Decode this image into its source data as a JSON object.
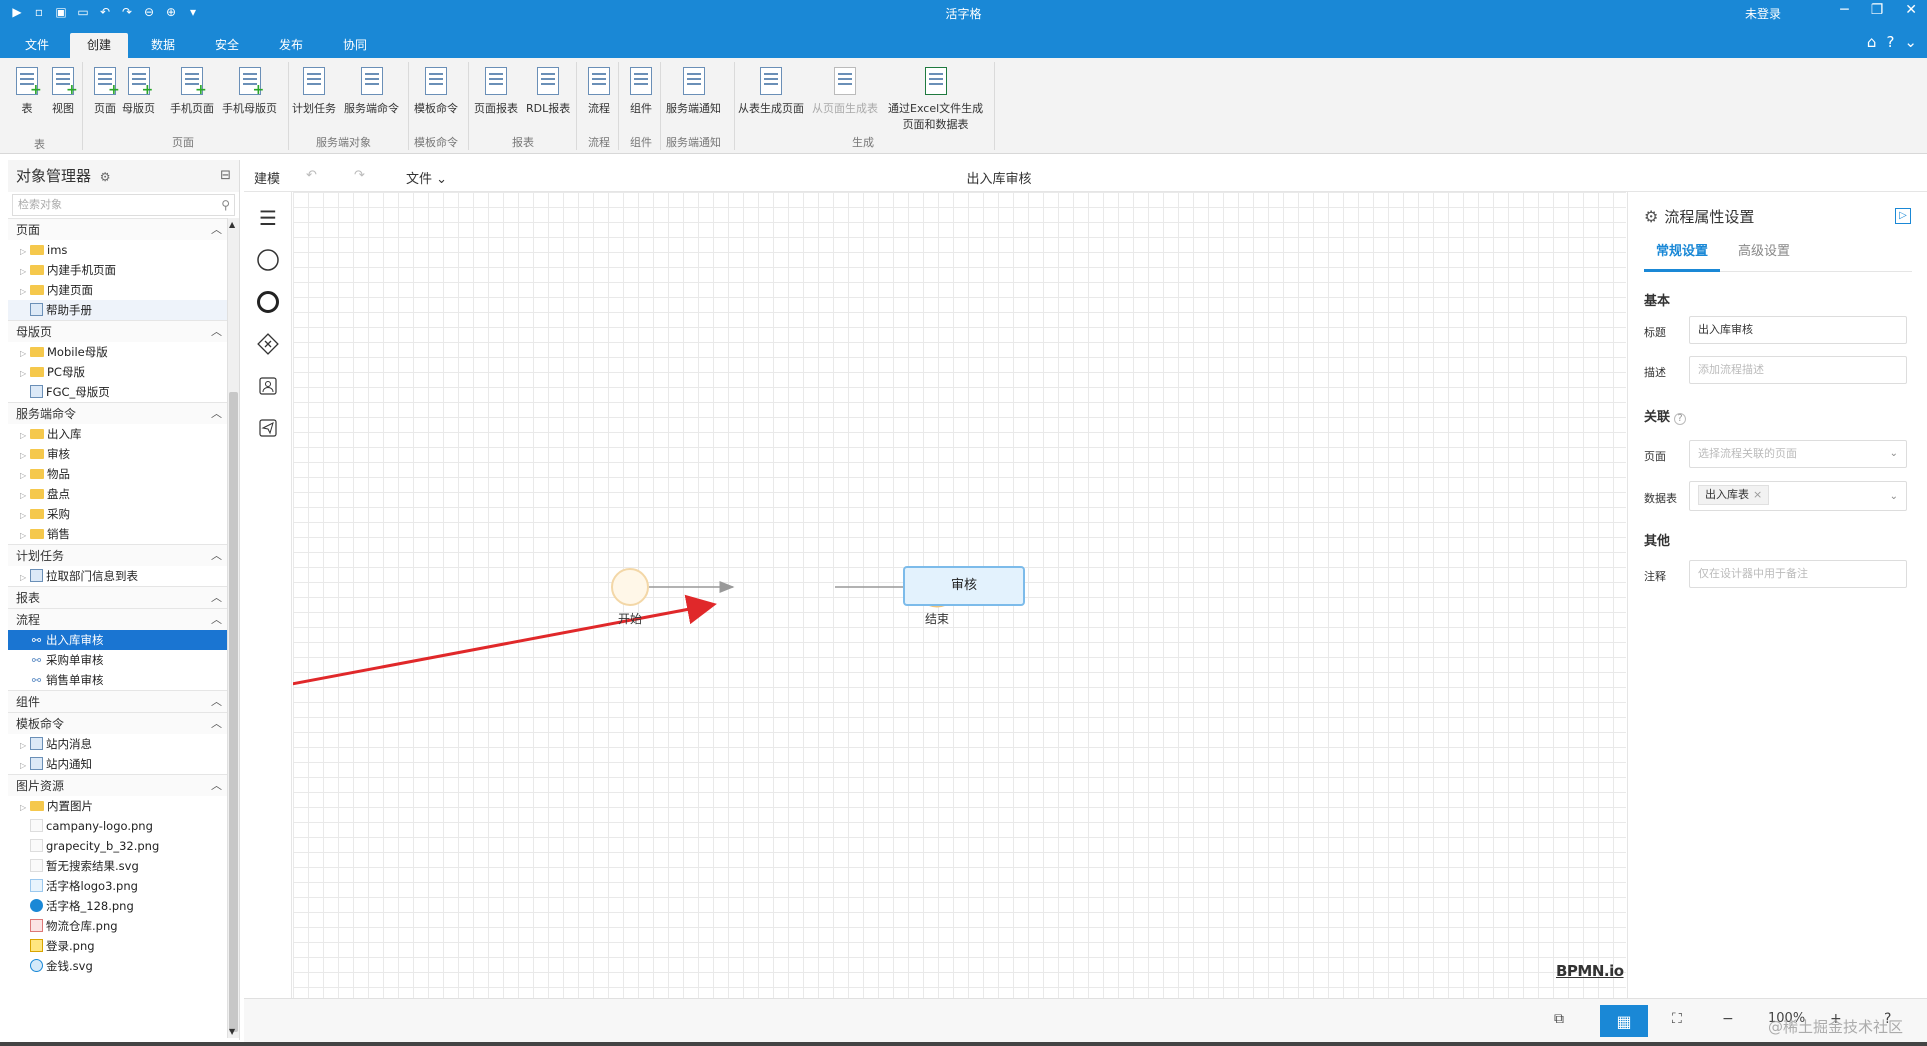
{
  "app": {
    "title": "活字格",
    "login_status": "未登录"
  },
  "menu_tabs": [
    "文件",
    "创建",
    "数据",
    "安全",
    "发布",
    "协同"
  ],
  "active_tab": "创建",
  "ribbon": {
    "buttons": [
      "表",
      "视图",
      "页面",
      "母版页",
      "手机页面",
      "手机母版页",
      "计划任务",
      "服务端命令",
      "模板命令",
      "页面报表",
      "RDL报表",
      "流程",
      "组件",
      "服务端通知",
      "从表生成页面",
      "从页面生成表",
      "通过Excel文件生成",
      "页面和数据表"
    ],
    "groups": [
      "表",
      "页面",
      "服务端对象",
      "模板命令",
      "报表",
      "流程",
      "组件",
      "服务端通知",
      "生成"
    ]
  },
  "object_manager": {
    "title": "对象管理器",
    "search_placeholder": "检索对象",
    "sections": {
      "pages": {
        "title": "页面",
        "items": [
          "ims",
          "内建手机页面",
          "内建页面",
          "帮助手册"
        ]
      },
      "masters": {
        "title": "母版页",
        "items": [
          "Mobile母版",
          "PC母版",
          "FGC_母版页"
        ]
      },
      "server_cmds": {
        "title": "服务端命令",
        "items": [
          "出入库",
          "审核",
          "物品",
          "盘点",
          "采购",
          "销售"
        ]
      },
      "schedules": {
        "title": "计划任务",
        "items": [
          "拉取部门信息到表"
        ]
      },
      "reports": {
        "title": "报表"
      },
      "flows": {
        "title": "流程",
        "items": [
          "出入库审核",
          "采购单审核",
          "销售单审核"
        ]
      },
      "components": {
        "title": "组件"
      },
      "templates": {
        "title": "模板命令",
        "items": [
          "站内消息",
          "站内通知"
        ]
      },
      "images": {
        "title": "图片资源",
        "items": [
          "内置图片",
          "campany-logo.png",
          "grapecity_b_32.png",
          "暂无搜索结果.svg",
          "活字格logo3.png",
          "活字格_128.png",
          "物流仓库.png",
          "登录.png",
          "金钱.svg"
        ]
      }
    }
  },
  "toolbar": {
    "mode": "建模",
    "file_menu": "文件",
    "document_title": "出入库审核"
  },
  "diagram": {
    "start_label": "开始",
    "task_label": "审核",
    "end_label": "结束",
    "brand": "BPMN.io"
  },
  "zoom": "100%",
  "properties": {
    "title": "流程属性设置",
    "tabs": [
      "常规设置",
      "高级设置"
    ],
    "section_basic": "基本",
    "label_title": "标题",
    "value_title": "出入库审核",
    "label_desc": "描述",
    "placeholder_desc": "添加流程描述",
    "section_link": "关联",
    "label_page": "页面",
    "placeholder_page": "选择流程关联的页面",
    "label_table": "数据表",
    "value_table": "出入库表",
    "section_other": "其他",
    "label_note": "注释",
    "placeholder_note": "仅在设计器中用于备注"
  },
  "watermark": "@稀土掘金技术社区",
  "colors": {
    "accent": "#1a88d6",
    "selected": "#1a75d2",
    "arrow": "#e0282a"
  }
}
